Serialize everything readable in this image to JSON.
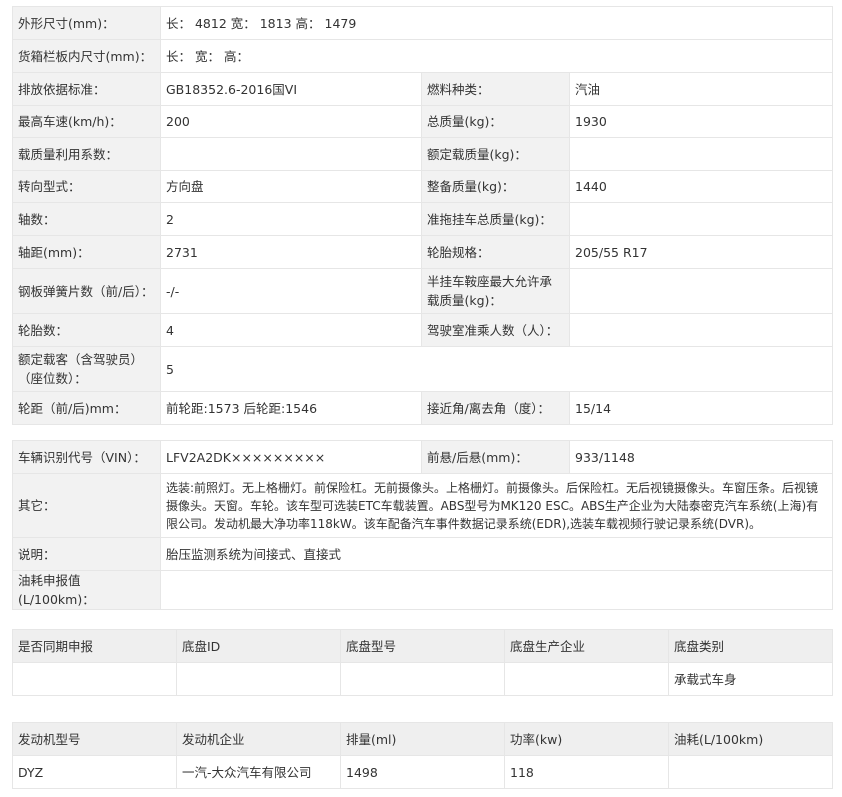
{
  "main_table": {
    "dimensions": {
      "label": "外形尺寸(mm)：",
      "value": "长： 4812 宽： 1813 高： 1479"
    },
    "cargo_box": {
      "label": "货箱栏板内尺寸(mm)：",
      "value": "长：  宽：  高："
    },
    "emission": {
      "label": "排放依据标准：",
      "value": "GB18352.6-2016国VI"
    },
    "fuel_type": {
      "label": "燃料种类：",
      "value": "汽油"
    },
    "max_speed": {
      "label": "最高车速(km/h)：",
      "value": "200"
    },
    "total_mass": {
      "label": "总质量(kg)：",
      "value": "1930"
    },
    "load_util": {
      "label": "载质量利用系数：",
      "value": ""
    },
    "rated_load": {
      "label": "额定载质量(kg)：",
      "value": ""
    },
    "steering": {
      "label": "转向型式：",
      "value": "方向盘"
    },
    "curb_mass": {
      "label": "整备质量(kg)：",
      "value": "1440"
    },
    "axles": {
      "label": "轴数：",
      "value": "2"
    },
    "trailer_mass": {
      "label": "准拖挂车总质量(kg)：",
      "value": ""
    },
    "wheelbase": {
      "label": "轴距(mm)：",
      "value": "2731"
    },
    "tire_spec": {
      "label": "轮胎规格：",
      "value": "205/55 R17"
    },
    "leaf_springs": {
      "label": "钢板弹簧片数（前/后）：",
      "value": "-/-"
    },
    "saddle_load": {
      "label": "半挂车鞍座最大允许承载质量(kg)：",
      "value": ""
    },
    "tires": {
      "label": "轮胎数：",
      "value": "4"
    },
    "cab_seats": {
      "label": "驾驶室准乘人数（人）：",
      "value": ""
    },
    "passengers": {
      "label": "额定载客（含驾驶员）（座位数）：",
      "value": "5"
    },
    "track": {
      "label": "轮距（前/后)mm：",
      "value": "前轮距:1573 后轮距:1546"
    },
    "angles": {
      "label": "接近角/离去角（度）：",
      "value": "15/14"
    }
  },
  "vin_table": {
    "vin": {
      "label": "车辆识别代号（VIN）：",
      "value": "LFV2A2DK×××××××××"
    },
    "overhang": {
      "label": "前悬/后悬(mm)：",
      "value": "933/1148"
    },
    "other": {
      "label": "其它：",
      "value": "选装:前照灯。无上格栅灯。前保险杠。无前摄像头。上格栅灯。前摄像头。后保险杠。无后视镜摄像头。车窗压条。后视镜摄像头。天窗。车轮。该车型可选装ETC车载装置。ABS型号为MK120 ESC。ABS生产企业为大陆泰密克汽车系统(上海)有限公司。发动机最大净功率118kW。该车配备汽车事件数据记录系统(EDR),选装车载视频行驶记录系统(DVR)。"
    },
    "notes": {
      "label": "说明：",
      "value": "胎压监测系统为间接式、直接式"
    },
    "fuel_consumption": {
      "label": "油耗申报值(L/100km)：",
      "value": ""
    }
  },
  "chassis_table": {
    "headers": [
      "是否同期申报",
      "底盘ID",
      "底盘型号",
      "底盘生产企业",
      "底盘类别"
    ],
    "row": [
      "",
      "",
      "",
      "",
      "承载式车身"
    ]
  },
  "engine_table": {
    "headers": [
      "发动机型号",
      "发动机企业",
      "排量(ml)",
      "功率(kw)",
      "油耗(L/100km)"
    ],
    "row": [
      "DYZ",
      "一汽-大众汽车有限公司",
      "1498",
      "118",
      ""
    ]
  }
}
